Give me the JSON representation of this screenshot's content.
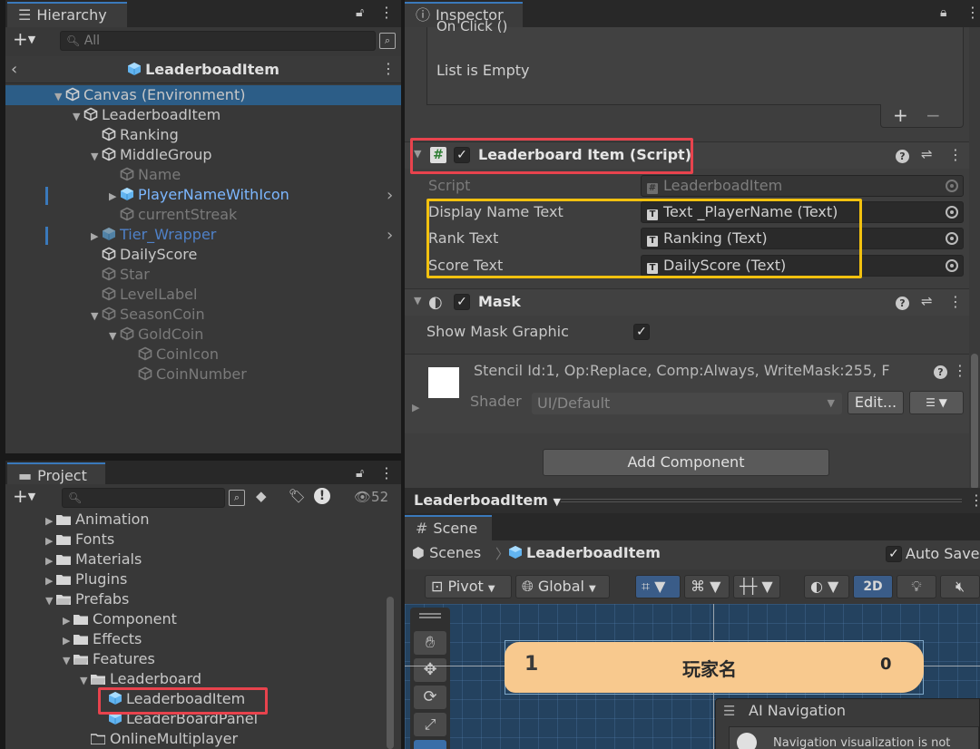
{
  "hierarchy": {
    "tab_label": "Hierarchy",
    "search_placeholder": "All",
    "breadcrumb": "LeaderboadItem",
    "rows": [
      {
        "label": "Canvas (Environment)",
        "color": "normal"
      },
      {
        "label": "LeaderboadItem",
        "color": "normal"
      },
      {
        "label": "Ranking",
        "color": "normal"
      },
      {
        "label": "MiddleGroup",
        "color": "normal"
      },
      {
        "label": "Name",
        "color": "gray"
      },
      {
        "label": "PlayerNameWithIcon",
        "color": "blue"
      },
      {
        "label": "currentStreak",
        "color": "gray"
      },
      {
        "label": "Tier_Wrapper",
        "color": "dblue"
      },
      {
        "label": "DailyScore",
        "color": "normal"
      },
      {
        "label": "Star",
        "color": "gray"
      },
      {
        "label": "LevelLabel",
        "color": "gray"
      },
      {
        "label": "SeasonCoin",
        "color": "gray"
      },
      {
        "label": "GoldCoin",
        "color": "gray"
      },
      {
        "label": "CoinIcon",
        "color": "gray"
      },
      {
        "label": "CoinNumber",
        "color": "gray"
      }
    ]
  },
  "inspector": {
    "tab_label": "Inspector",
    "onclick_label": "On Click ()",
    "list_empty": "List is Empty",
    "add_glyph": "+",
    "remove_glyph": "−",
    "script_component": {
      "title": "Leaderboard Item (Script)",
      "fields": [
        {
          "label": "Script",
          "value": "LeaderboadItem"
        },
        {
          "label": "Display Name Text",
          "value": "Text _PlayerName (Text)"
        },
        {
          "label": "Rank Text",
          "value": "Ranking (Text)"
        },
        {
          "label": "Score Text",
          "value": "DailyScore (Text)"
        }
      ]
    },
    "mask_component": {
      "title": "Mask",
      "show_mask_graphic_label": "Show Mask Graphic"
    },
    "material": {
      "stencil": "Stencil Id:1, Op:Replace, Comp:Always, WriteMask:255, F",
      "shader_label": "Shader",
      "shader_value": "UI/Default",
      "edit_button": "Edit..."
    },
    "add_component_button": "Add Component"
  },
  "project": {
    "tab_label": "Project",
    "hidden_count": "52",
    "items": [
      {
        "label": "Animation",
        "depth": 0,
        "type": "folder",
        "expanded": false
      },
      {
        "label": "Fonts",
        "depth": 0,
        "type": "folder",
        "expanded": false
      },
      {
        "label": "Materials",
        "depth": 0,
        "type": "folder",
        "expanded": false
      },
      {
        "label": "Plugins",
        "depth": 0,
        "type": "folder",
        "expanded": false
      },
      {
        "label": "Prefabs",
        "depth": 0,
        "type": "folder",
        "expanded": true
      },
      {
        "label": "Component",
        "depth": 1,
        "type": "folder",
        "expanded": false
      },
      {
        "label": "Effects",
        "depth": 1,
        "type": "folder",
        "expanded": false
      },
      {
        "label": "Features",
        "depth": 1,
        "type": "folder",
        "expanded": true
      },
      {
        "label": "Leaderboard",
        "depth": 2,
        "type": "folder",
        "expanded": true
      },
      {
        "label": "LeaderboadItem",
        "depth": 3,
        "type": "prefab"
      },
      {
        "label": "LeaderBoardPanel",
        "depth": 3,
        "type": "prefab"
      },
      {
        "label": "OnlineMultiplayer",
        "depth": 2,
        "type": "folder-empty"
      }
    ]
  },
  "prefab_bar": {
    "label": "LeaderboadItem"
  },
  "scene": {
    "tab_label": "Scene",
    "scenes_label": "Scenes",
    "prefab_label": "LeaderboadItem",
    "auto_save_label": "Auto Save",
    "pivot_label": "Pivot",
    "global_label": "Global",
    "mode_2d": "2D",
    "item_rank": "1",
    "item_name": "玩家名",
    "item_score": "0",
    "ai_nav_title": "AI Navigation",
    "ai_nav_text": "Navigation visualization is not"
  },
  "colors": {
    "highlight_red": "#e8434d",
    "highlight_yellow": "#f2c10f",
    "selection_blue": "#2c5d87",
    "accent_blue": "#3a79bb"
  }
}
